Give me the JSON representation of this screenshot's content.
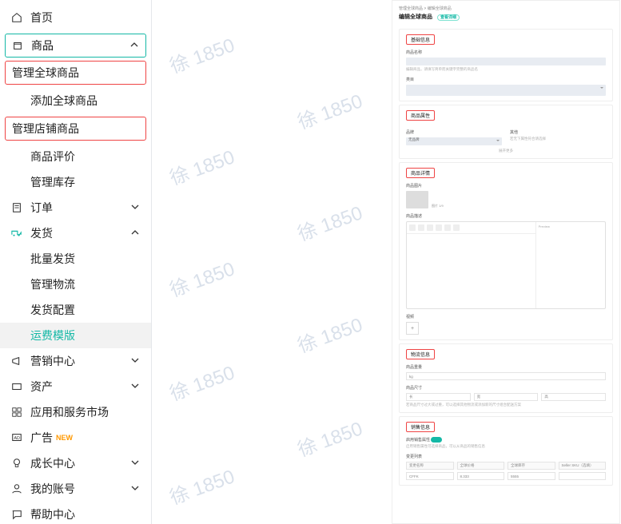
{
  "sidebar": {
    "home": "首页",
    "product": "商品",
    "sub_manage_global": "管理全球商品",
    "sub_add_global": "添加全球商品",
    "sub_manage_shop": "管理店铺商品",
    "sub_reviews": "商品评价",
    "sub_stock": "管理库存",
    "orders": "订单",
    "ship": "发货",
    "ship_batch": "批量发货",
    "ship_logistics": "管理物流",
    "ship_config": "发货配置",
    "ship_tpl": "运费模版",
    "marketing": "营销中心",
    "asset": "资产",
    "market": "应用和服务市场",
    "ads": "广告",
    "ads_new": "NEW",
    "growth": "成长中心",
    "account": "我的账号",
    "help": "帮助中心"
  },
  "watermark": "徐 1850",
  "right": {
    "crumbs": "管理全球商品 > 编辑全球商品",
    "title": "编辑全球商品",
    "title_badge": "查看详细",
    "s1": "基础信息",
    "s1_name": "商品名称",
    "s1_hint": "编辑商品，请填写简单而关键字完整的商品名",
    "s1_cat": "类目",
    "s2": "商品属性",
    "s2_brand": "品牌",
    "s2_brand_val": "无品牌",
    "s2_other": "其他",
    "s2_other_hint": "若无下属性符合请选择",
    "s2_more": "展开更多",
    "s3": "商品详情",
    "s3_img": "商品图片",
    "s3_img_lbl": "图片 1/9",
    "s3_desc": "商品描述",
    "s3_preview": "Preview",
    "s3_video": "视频",
    "s4": "物流信息",
    "s4_weight": "商品重量",
    "s4_unit": "kg",
    "s4_size": "商品尺寸",
    "s4_size_hint": "若商品尺寸过大或过重，可以选择其他物流或添加新的尺寸组合配送方案",
    "s4_len": "长",
    "s4_wid": "宽",
    "s4_hei": "高",
    "s5": "销售信息",
    "s5_toggle": "启用销售属性",
    "s5_hint": "启用销售属性可选择商品，可以从商品的销售信息",
    "s5_list": "变更列表",
    "s5_col1": "变更名称",
    "s5_col2": "全球价格",
    "s5_col3": "全球库存",
    "s5_col4": "Seller SKU（选填）",
    "s5_row_v": "CFFK",
    "s5_row_p": "8.333",
    "s5_row_s": "5555"
  }
}
